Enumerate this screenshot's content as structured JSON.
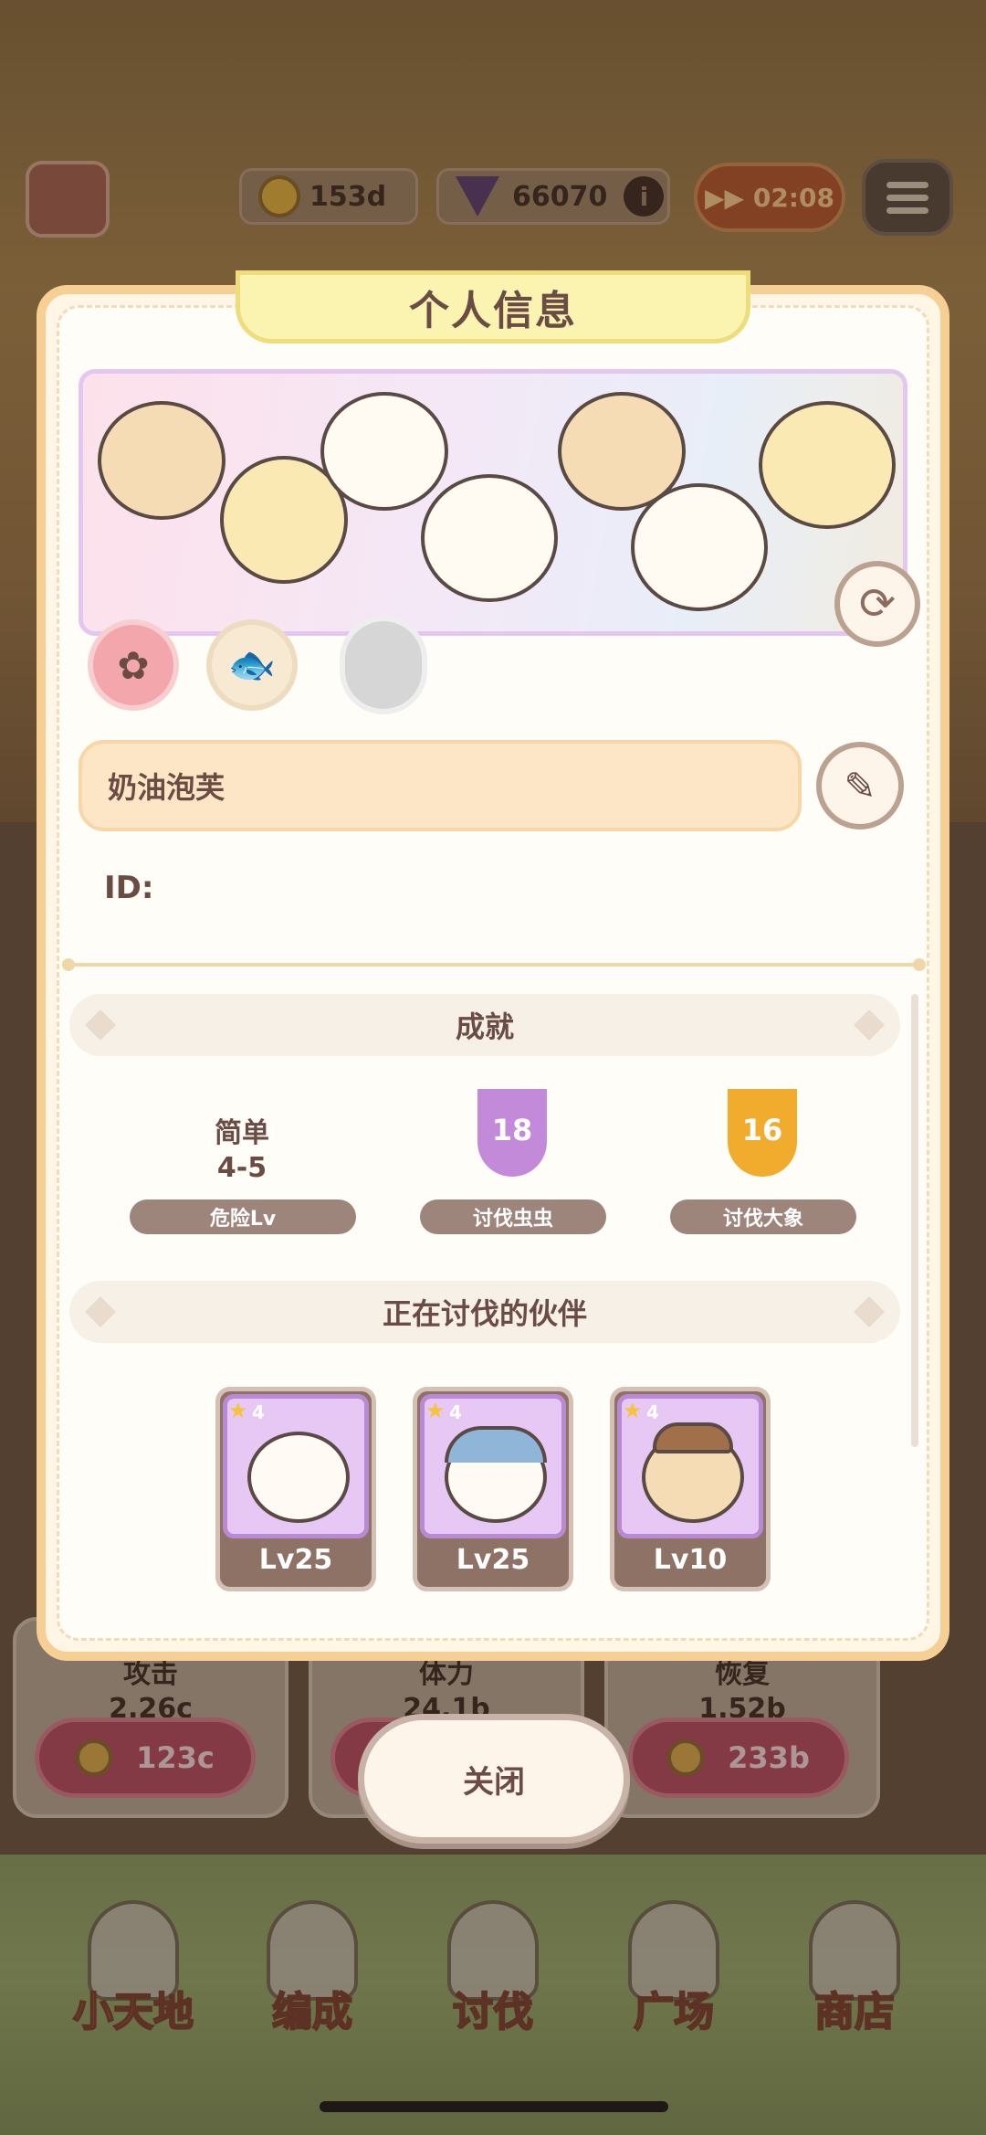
{
  "hud": {
    "coin_value": "153d",
    "gem_value": "66070",
    "timer": "▶▶ 02:08",
    "info_glyph": "i"
  },
  "modal": {
    "title": "个人信息",
    "player_name": "奶油泡芙",
    "id_label": "ID:",
    "achievements": {
      "header": "成就",
      "items": [
        {
          "value": "简单\n4-5",
          "label": "危险Lv"
        },
        {
          "value": "18",
          "label": "讨伐虫虫",
          "trophy_color": "#c38ad9"
        },
        {
          "value": "16",
          "label": "讨伐大象",
          "trophy_color": "#f1ac2e"
        }
      ]
    },
    "companions": {
      "header": "正在讨伐的伙伴",
      "cards": [
        {
          "stars": "4",
          "level": "Lv25"
        },
        {
          "stars": "4",
          "level": "Lv25"
        },
        {
          "stars": "4",
          "level": "Lv10"
        }
      ]
    }
  },
  "stats": [
    {
      "name": "攻击",
      "value": "2.26c",
      "cost": "123c"
    },
    {
      "name": "体力",
      "value": "24.1b",
      "cost": ""
    },
    {
      "name": "恢复",
      "value": "1.52b",
      "cost": "233b"
    }
  ],
  "close_label": "关闭",
  "nav": [
    {
      "label": "小天地",
      "icon": "home-icon"
    },
    {
      "label": "编成",
      "icon": "team-icon"
    },
    {
      "label": "讨伐",
      "icon": "battle-icon"
    },
    {
      "label": "广场",
      "icon": "signpost-icon"
    },
    {
      "label": "商店",
      "icon": "shop-icon"
    }
  ],
  "colors": {
    "accent": "#f6cf95",
    "title_banner": "#fbf3b0",
    "buy_button": "#b44a5e",
    "card_frame": "#b98ad3"
  }
}
